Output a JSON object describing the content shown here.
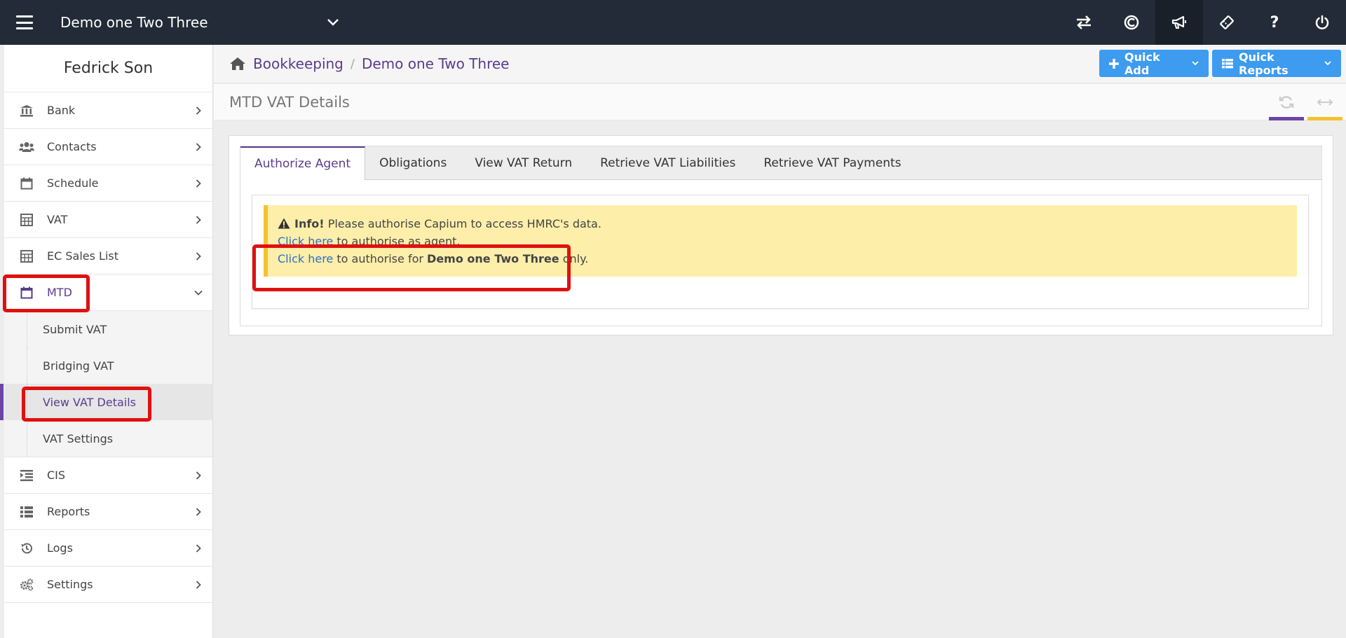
{
  "topbar": {
    "company": "Demo one Two Three",
    "icons": [
      "transfer-icon",
      "capium-icon",
      "megaphone-icon",
      "ticket-icon",
      "help-icon",
      "power-icon"
    ],
    "help_glyph": "?"
  },
  "sidebar": {
    "user_name": "Fedrick Son",
    "items": [
      {
        "label": "Bank",
        "icon": "bank-icon"
      },
      {
        "label": "Contacts",
        "icon": "users-icon"
      },
      {
        "label": "Schedule",
        "icon": "calendar-icon"
      },
      {
        "label": "VAT",
        "icon": "calculator-icon"
      },
      {
        "label": "EC Sales List",
        "icon": "calculator-icon"
      },
      {
        "label": "MTD",
        "icon": "calendar-icon",
        "open": true
      },
      {
        "label": "CIS",
        "icon": "indent-icon"
      },
      {
        "label": "Reports",
        "icon": "list-icon"
      },
      {
        "label": "Logs",
        "icon": "history-icon"
      },
      {
        "label": "Settings",
        "icon": "cogs-icon"
      }
    ],
    "mtd_submenu": [
      "Submit VAT",
      "Bridging VAT",
      "View VAT Details",
      "VAT Settings"
    ],
    "active_submenu": "View VAT Details"
  },
  "breadcrumb": {
    "section": "Bookkeeping",
    "separator": "/",
    "company": "Demo one Two Three"
  },
  "header_buttons": {
    "quick_add": "Quick Add",
    "quick_reports": "Quick Reports"
  },
  "page": {
    "title": "MTD VAT Details"
  },
  "tabs": [
    "Authorize Agent",
    "Obligations",
    "View VAT Return",
    "Retrieve VAT Liabilities",
    "Retrieve VAT Payments"
  ],
  "active_tab": "Authorize Agent",
  "alert": {
    "heading": "Info!",
    "message": "Please authorise Capium to access HMRC's data.",
    "link1": "Click here",
    "line1_rest": "to authorise as agent.",
    "link2": "Click here",
    "line2_pre": "to authorise for",
    "line2_company": "Demo one Two Three",
    "line2_post": "only."
  },
  "colors": {
    "topbar": "#222b37",
    "accent_purple": "#5b3c8c",
    "button_blue": "#3d9bf0",
    "alert_bg": "#fdeeaa",
    "alert_border": "#f5c22e",
    "highlight_red": "#e01010"
  }
}
